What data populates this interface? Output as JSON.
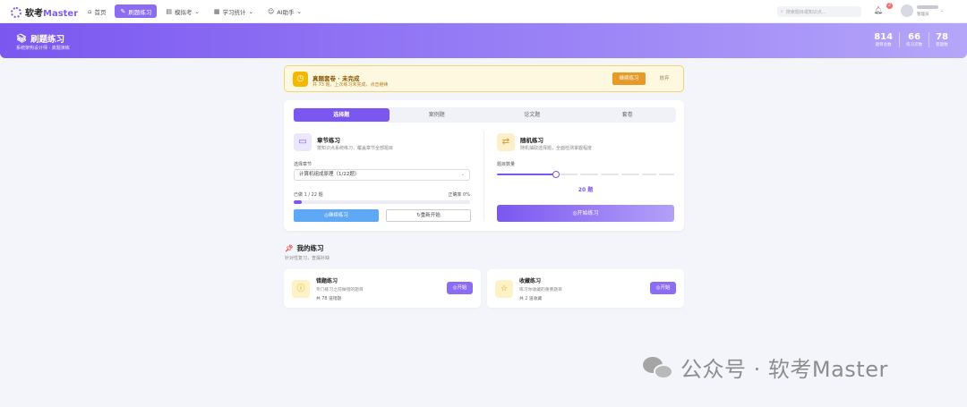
{
  "app": {
    "name_prefix": "软考",
    "name_suffix": "Master"
  },
  "nav": {
    "items": [
      {
        "label": "首页",
        "icon": "home-icon"
      },
      {
        "label": "刷题练习",
        "icon": "edit-icon",
        "active": true
      },
      {
        "label": "模拟考",
        "icon": "document-icon"
      },
      {
        "label": "学习统计",
        "icon": "chart-icon"
      },
      {
        "label": "AI助手",
        "icon": "robot-icon"
      }
    ]
  },
  "search": {
    "placeholder": "搜索题目或知识点..."
  },
  "notifications": {
    "count": "2"
  },
  "user": {
    "role": "管理员"
  },
  "banner": {
    "title": "刷题练习",
    "subtitle": "系统架构设计师 · 真题演练",
    "stats": [
      {
        "value": "814",
        "label": "题目总数"
      },
      {
        "value": "66",
        "label": "练习次数"
      },
      {
        "value": "78",
        "label": "错题数"
      }
    ]
  },
  "reminder": {
    "title": "真题套卷 · 未完成",
    "desc": "共 73 题，上次练习未完成，点击继续",
    "continue_label": "继续练习",
    "giveup_label": "放弃"
  },
  "tabs": [
    {
      "label": "选择题",
      "active": true
    },
    {
      "label": "案例题"
    },
    {
      "label": "论文题"
    },
    {
      "label": "套卷"
    }
  ],
  "chapter": {
    "title": "章节练习",
    "desc": "按知识点系统练习，覆盖章节全部题目",
    "select_label": "选择章节",
    "selected": "计算机组成原理（1/22题）",
    "done_text": "已做 1 / 22 题",
    "accuracy_text": "正确率 0%",
    "progress": 0.045,
    "continue_label": "继续练习",
    "restart_label": "重新开始"
  },
  "random": {
    "title": "随机练习",
    "desc": "随机抽取选择题，全面检测掌握程度",
    "count_label": "题目数量",
    "count_value": 20,
    "count_text": "20 题",
    "slider_min": 10,
    "slider_max": 100,
    "start_label": "开始练习"
  },
  "my_practice": {
    "title": "我的练习",
    "subtitle": "针对性复习，查漏补缺",
    "cards": [
      {
        "title": "错题练习",
        "desc": "专门练习之前做错的题目",
        "count": "共 78 道错题",
        "button": "开始",
        "icon": "alert-circle-icon"
      },
      {
        "title": "收藏练习",
        "desc": "练习你收藏的重要题目",
        "count": "共 2 道收藏",
        "button": "开始",
        "icon": "star-icon"
      }
    ]
  },
  "watermark": {
    "text": "公众号 · 软考Master"
  },
  "colors": {
    "accent": "#7b57f0",
    "warning": "#e89a28",
    "info": "#5fa8f5"
  }
}
